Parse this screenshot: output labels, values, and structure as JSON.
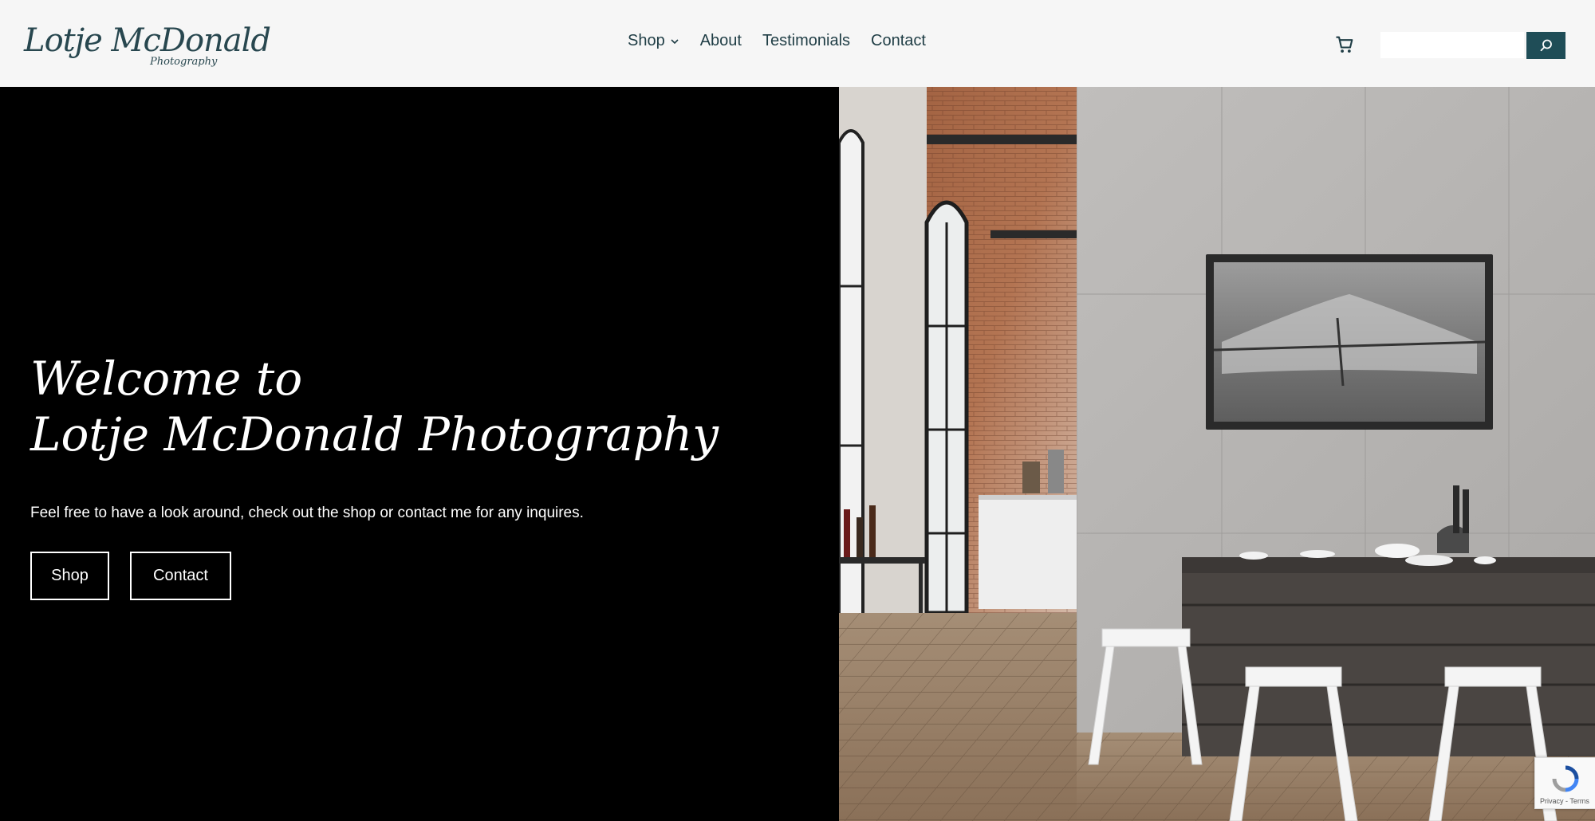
{
  "brand": {
    "logo_text": "Lotje McDonald",
    "logo_subtext": "Photography"
  },
  "nav": {
    "items": [
      {
        "label": "Shop",
        "has_dropdown": true
      },
      {
        "label": "About"
      },
      {
        "label": "Testimonials"
      },
      {
        "label": "Contact"
      }
    ]
  },
  "header": {
    "cart_icon": "cart-icon",
    "search_icon": "search-icon",
    "search_value": ""
  },
  "hero": {
    "title_line1": "Welcome to",
    "title_line2": "Lotje McDonald Photography",
    "subtitle": "Feel free to have a look around, check out the shop or contact me for any inquires.",
    "buttons": [
      {
        "label": "Shop"
      },
      {
        "label": "Contact"
      }
    ]
  },
  "recaptcha": {
    "text": "Privacy - Terms"
  },
  "colors": {
    "header_bg": "#f6f6f6",
    "brand_teal": "#1f4d57",
    "nav_text": "#1f3d45",
    "hero_bg": "#000000"
  }
}
